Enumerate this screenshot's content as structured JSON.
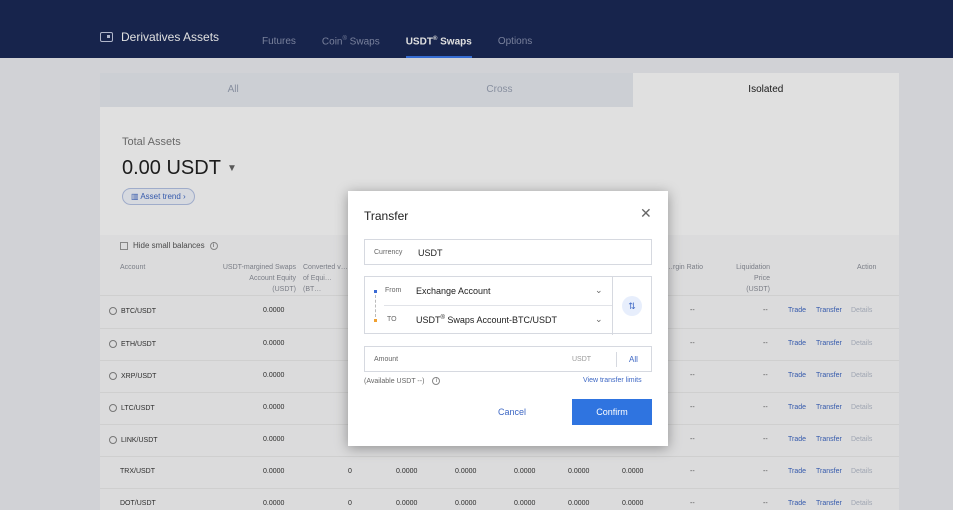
{
  "nav": {
    "brand": "Derivatives Assets",
    "tabs": [
      {
        "label": "Futures"
      },
      {
        "label": "Coin",
        "sup": "®",
        "suffix": " Swaps"
      },
      {
        "label": "USDT",
        "sup": "®",
        "suffix": " Swaps"
      },
      {
        "label": "Options"
      }
    ]
  },
  "segments": [
    "All",
    "Cross",
    "Isolated"
  ],
  "summary": {
    "label": "Total Assets",
    "value": "0.00 USDT",
    "trend_btn": "Asset trend"
  },
  "table": {
    "hide_small": "Hide small balances",
    "headers": {
      "account": "Account",
      "equity": "USDT-margined Swaps Account Equity",
      "equity_unit": "(USDT)",
      "converted": "Converted v… of Equi…",
      "converted_unit": "(BT…",
      "margin_ratio": "…rgin Ratio",
      "liq_price": "Liquidation Price",
      "liq_unit": "(USDT)",
      "action": "Action"
    },
    "rows": [
      {
        "pair": "BTC/USDT",
        "equity": "0.0000"
      },
      {
        "pair": "ETH/USDT",
        "equity": "0.0000"
      },
      {
        "pair": "XRP/USDT",
        "equity": "0.0000"
      },
      {
        "pair": "LTC/USDT",
        "equity": "0.0000"
      },
      {
        "pair": "LINK/USDT",
        "equity": "0.0000"
      },
      {
        "pair": "TRX/USDT",
        "equity": "0.0000",
        "c3": "0",
        "c4": "0.0000",
        "c5": "0.0000",
        "c6": "0.0000",
        "c7": "0.0000",
        "c8": "0.0000"
      },
      {
        "pair": "DOT/USDT",
        "equity": "0.0000",
        "c3": "0",
        "c4": "0.0000",
        "c5": "0.0000",
        "c6": "0.0000",
        "c7": "0.0000",
        "c8": "0.0000"
      }
    ],
    "dash": "--",
    "actions": [
      "Trade",
      "Transfer",
      "Details"
    ]
  },
  "modal": {
    "title": "Transfer",
    "currency_label": "Currency",
    "currency_value": "USDT",
    "from_label": "From",
    "from_value": "Exchange Account",
    "to_label": "TO",
    "to_value_prefix": "USDT",
    "to_value_sup": "®",
    "to_value_suffix": " Swaps Account-BTC/USDT",
    "amount_label": "Amount",
    "amount_unit": "USDT",
    "amount_all": "All",
    "available": "(Available USDT --)",
    "limits_link": "View transfer limits",
    "cancel": "Cancel",
    "confirm": "Confirm"
  }
}
